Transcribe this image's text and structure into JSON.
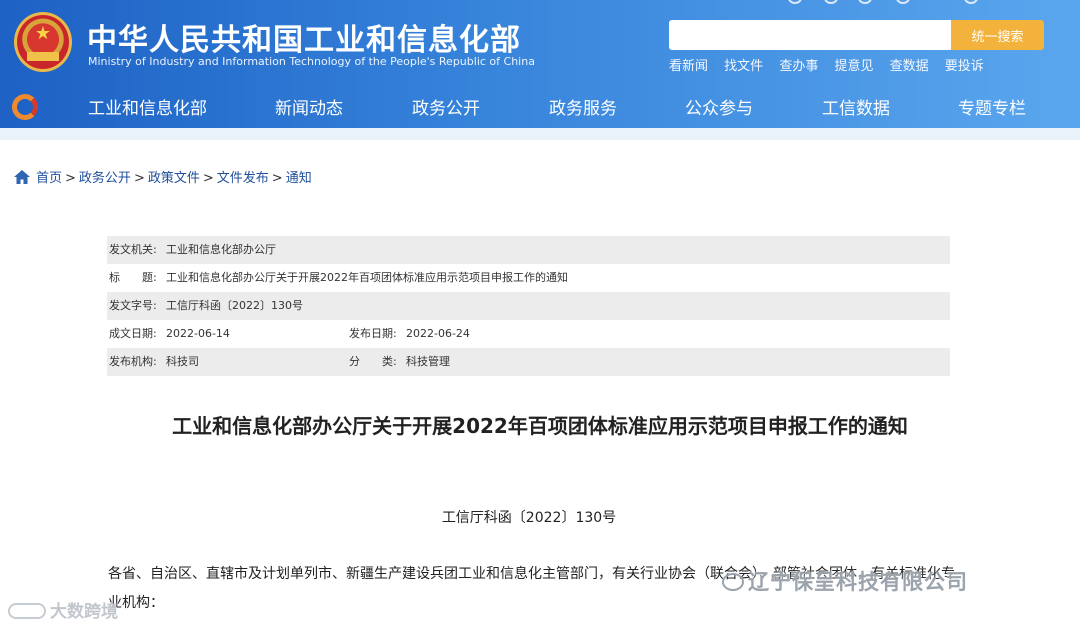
{
  "header": {
    "title": "中华人民共和国工业和信息化部",
    "subtitle": "Ministry of Industry and Information Technology of the People's Republic of China",
    "emblem_icon": "national-emblem-icon",
    "brand_color": "#2f7ad6"
  },
  "search": {
    "placeholder": "",
    "button_label": "统一搜索",
    "button_color": "#f2b23c"
  },
  "quick_links": [
    "看新闻",
    "找文件",
    "查办事",
    "提意见",
    "查数据",
    "要投诉"
  ],
  "nav": {
    "logo_icon": "miit-logo-icon",
    "items": [
      "工业和信息化部",
      "新闻动态",
      "政务公开",
      "政务服务",
      "公众参与",
      "工信数据",
      "专题专栏"
    ]
  },
  "breadcrumb": {
    "icon": "home-icon",
    "items": [
      "首页",
      "政务公开",
      "政策文件",
      "文件发布",
      "通知"
    ],
    "separator": ">"
  },
  "meta": {
    "issuer_label": "发文机关:",
    "issuer": "工业和信息化部办公厅",
    "title_label": "标　　题:",
    "title": "工业和信息化部办公厅关于开展2022年百项团体标准应用示范项目申报工作的通知",
    "doc_no_label": "发文字号:",
    "doc_no": "工信厅科函〔2022〕130号",
    "written_date_label": "成文日期:",
    "written_date": "2022-06-14",
    "publish_date_label": "发布日期:",
    "publish_date": "2022-06-24",
    "org_label": "发布机构:",
    "org": "科技司",
    "category_label": "分　　类:",
    "category": "科技管理"
  },
  "document": {
    "title": "工业和信息化部办公厅关于开展2022年百项团体标准应用示范项目申报工作的通知",
    "number": "工信厅科函〔2022〕130号",
    "body": "各省、自治区、直辖市及计划单列市、新疆生产建设兵团工业和信息化主管部门，有关行业协会（联合会）、部管社会团体，有关标准化专业机构："
  },
  "watermarks": {
    "right": "辽宁保呈科技有限公司",
    "left": "大数跨境"
  }
}
